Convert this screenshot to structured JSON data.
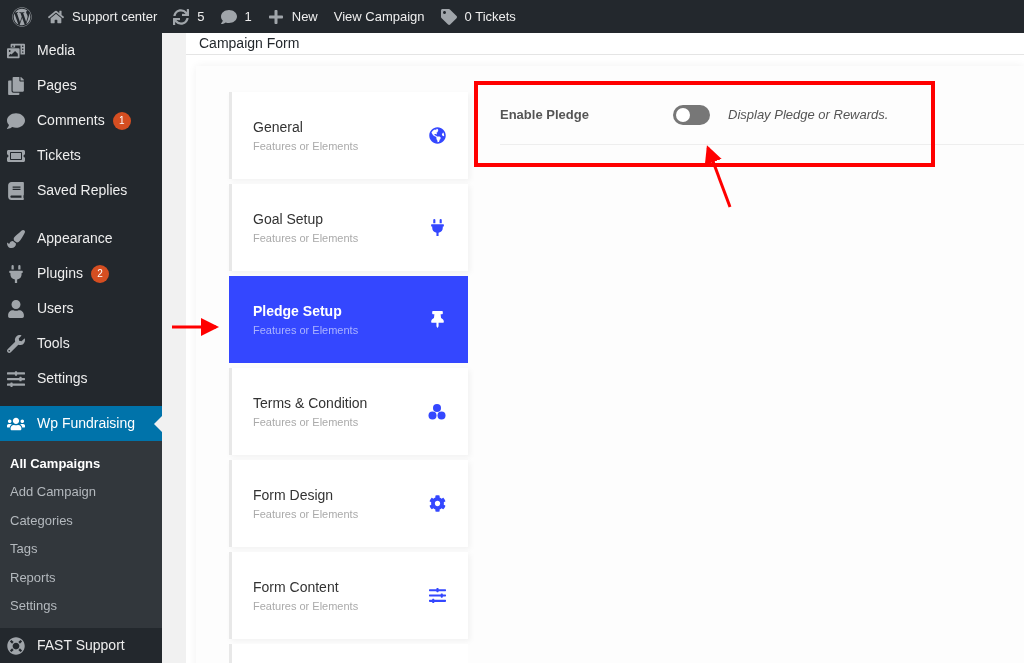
{
  "top_bar": {
    "items": [
      {
        "kind": "site",
        "label": "Support center"
      },
      {
        "kind": "updates",
        "label": "5"
      },
      {
        "kind": "comments",
        "label": "1"
      },
      {
        "kind": "new",
        "label": "New"
      },
      {
        "kind": "link",
        "label": "View Campaign"
      },
      {
        "kind": "tickets",
        "label": "0 Tickets"
      }
    ]
  },
  "sidebar": {
    "groups": [
      [
        {
          "label": "Media",
          "selected": false
        },
        {
          "label": "Pages",
          "selected": false
        },
        {
          "label": "Comments",
          "badge": "1",
          "selected": false
        },
        {
          "label": "Tickets",
          "selected": false
        },
        {
          "label": "Saved Replies",
          "selected": false
        }
      ],
      [
        {
          "label": "Appearance",
          "selected": false
        },
        {
          "label": "Plugins",
          "badge": "2",
          "selected": false
        },
        {
          "label": "Users",
          "selected": false
        },
        {
          "label": "Tools",
          "selected": false
        },
        {
          "label": "Settings",
          "selected": false
        }
      ],
      [
        {
          "label": "Wp Fundraising",
          "selected": true,
          "children": [
            {
              "label": "All Campaigns",
              "selected": true
            },
            {
              "label": "Add Campaign",
              "selected": false
            },
            {
              "label": "Categories",
              "selected": false
            },
            {
              "label": "Tags",
              "selected": false
            },
            {
              "label": "Reports",
              "selected": false
            },
            {
              "label": "Settings",
              "selected": false
            }
          ]
        },
        {
          "label": "FAST Support",
          "selected": false
        }
      ]
    ]
  },
  "page": {
    "title": "Campaign Form",
    "tabs": [
      {
        "title": "General",
        "subtitle": "Features or Elements",
        "selected": false
      },
      {
        "title": "Goal Setup",
        "subtitle": "Features or Elements",
        "selected": false
      },
      {
        "title": "Pledge Setup",
        "subtitle": "Features or Elements",
        "selected": true
      },
      {
        "title": "Terms & Condition",
        "subtitle": "Features or Elements",
        "selected": false
      },
      {
        "title": "Form Design",
        "subtitle": "Features or Elements",
        "selected": false
      },
      {
        "title": "Form Content",
        "subtitle": "Features or Elements",
        "selected": false
      }
    ],
    "setting": {
      "label": "Enable Pledge",
      "on": false,
      "description": "Display Pledge or Rewards."
    }
  }
}
